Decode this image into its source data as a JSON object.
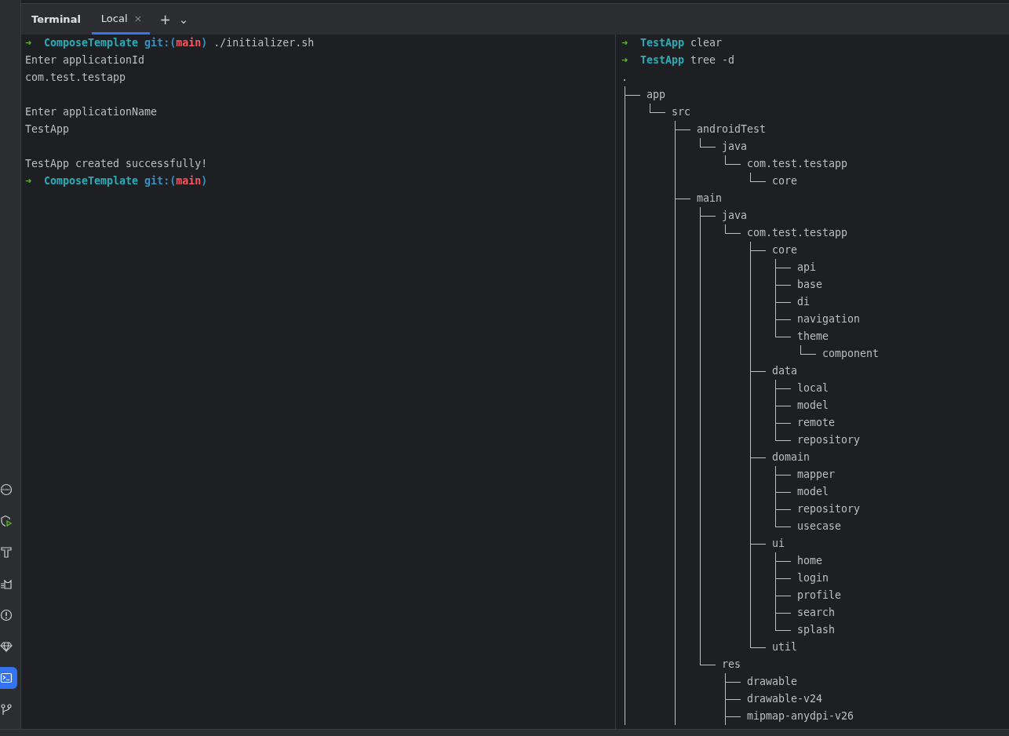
{
  "tool_window": {
    "title": "Terminal"
  },
  "tabs": [
    {
      "label": "Local",
      "selected": true,
      "close": "×"
    }
  ],
  "tab_actions": {
    "add": "+",
    "menu": "⌄"
  },
  "sidebar": {
    "items": [
      {
        "selected": false
      },
      {
        "selected": false
      },
      {
        "selected": false
      },
      {
        "selected": false
      },
      {
        "selected": false
      },
      {
        "selected": false
      },
      {
        "selected": true
      },
      {
        "selected": false
      }
    ]
  },
  "left_session": {
    "lines": [
      {
        "kind": "prompt",
        "arrow": "➜",
        "dir": "ComposeTemplate",
        "git_label": "git:(",
        "branch": "main",
        "git_close": ")",
        "command": "./initializer.sh"
      },
      {
        "kind": "output",
        "text": "Enter applicationId"
      },
      {
        "kind": "output",
        "text": "com.test.testapp"
      },
      {
        "kind": "blank"
      },
      {
        "kind": "output",
        "text": "Enter applicationName"
      },
      {
        "kind": "output",
        "text": "TestApp"
      },
      {
        "kind": "blank"
      },
      {
        "kind": "output",
        "text": "TestApp created successfully!"
      },
      {
        "kind": "prompt",
        "arrow": "➜",
        "dir": "ComposeTemplate",
        "git_label": "git:(",
        "branch": "main",
        "git_close": ")"
      }
    ]
  },
  "right_session": {
    "lines": [
      {
        "kind": "prompt",
        "arrow": "➜",
        "dir": "TestApp",
        "command": "clear"
      },
      {
        "kind": "prompt",
        "arrow": "➜",
        "dir": "TestApp",
        "command": "tree -d"
      }
    ],
    "tree": {
      "name": ".",
      "children": [
        {
          "name": "app",
          "last": false,
          "children": [
            {
              "name": "src",
              "last": true,
              "children": [
                {
                  "name": "androidTest",
                  "last": false,
                  "children": [
                    {
                      "name": "java",
                      "last": true,
                      "children": [
                        {
                          "name": "com.test.testapp",
                          "last": true,
                          "children": [
                            {
                              "name": "core",
                              "last": true
                            }
                          ]
                        }
                      ]
                    }
                  ]
                },
                {
                  "name": "main",
                  "last": false,
                  "children": [
                    {
                      "name": "java",
                      "last": false,
                      "children": [
                        {
                          "name": "com.test.testapp",
                          "last": true,
                          "children": [
                            {
                              "name": "core",
                              "last": false,
                              "children": [
                                {
                                  "name": "api",
                                  "last": false
                                },
                                {
                                  "name": "base",
                                  "last": false
                                },
                                {
                                  "name": "di",
                                  "last": false
                                },
                                {
                                  "name": "navigation",
                                  "last": false
                                },
                                {
                                  "name": "theme",
                                  "last": true,
                                  "children": [
                                    {
                                      "name": "component",
                                      "last": true
                                    }
                                  ]
                                }
                              ]
                            },
                            {
                              "name": "data",
                              "last": false,
                              "children": [
                                {
                                  "name": "local",
                                  "last": false
                                },
                                {
                                  "name": "model",
                                  "last": false
                                },
                                {
                                  "name": "remote",
                                  "last": false
                                },
                                {
                                  "name": "repository",
                                  "last": true
                                }
                              ]
                            },
                            {
                              "name": "domain",
                              "last": false,
                              "children": [
                                {
                                  "name": "mapper",
                                  "last": false
                                },
                                {
                                  "name": "model",
                                  "last": false
                                },
                                {
                                  "name": "repository",
                                  "last": false
                                },
                                {
                                  "name": "usecase",
                                  "last": true
                                }
                              ]
                            },
                            {
                              "name": "ui",
                              "last": false,
                              "children": [
                                {
                                  "name": "home",
                                  "last": false
                                },
                                {
                                  "name": "login",
                                  "last": false
                                },
                                {
                                  "name": "profile",
                                  "last": false
                                },
                                {
                                  "name": "search",
                                  "last": false
                                },
                                {
                                  "name": "splash",
                                  "last": true
                                }
                              ]
                            },
                            {
                              "name": "util",
                              "last": true
                            }
                          ]
                        }
                      ]
                    },
                    {
                      "name": "res",
                      "last": true,
                      "children": [
                        {
                          "name": "drawable",
                          "last": false
                        },
                        {
                          "name": "drawable-v24",
                          "last": false
                        },
                        {
                          "name": "mipmap-anydpi-v26",
                          "last": false
                        }
                      ]
                    }
                  ]
                }
              ]
            }
          ]
        }
      ]
    }
  }
}
